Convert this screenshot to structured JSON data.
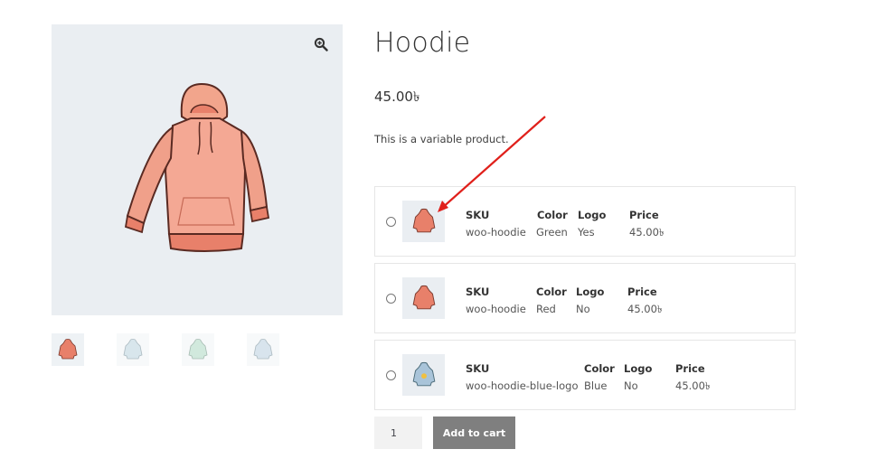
{
  "product": {
    "title": "Hoodie",
    "price": "45.00৳",
    "description": "This is a variable product."
  },
  "gallery": {
    "zoom_icon": "zoom-in-icon",
    "main_image": "pink-hoodie-image",
    "thumbnails": [
      {
        "name": "pink-hoodie",
        "color": "#e8806a"
      },
      {
        "name": "blue-hoodie",
        "color": "#a9c9d6"
      },
      {
        "name": "green-hoodie",
        "color": "#9bd0b6"
      },
      {
        "name": "blue-hoodie-logo",
        "color": "#a9c4d9"
      }
    ]
  },
  "variations": [
    {
      "headers": {
        "sku": "SKU",
        "color": "Color",
        "logo": "Logo",
        "price": "Price"
      },
      "values": {
        "sku": "woo-hoodie",
        "color": "Green",
        "logo": "Yes",
        "price": "45.00৳"
      },
      "image_color": "#e8806a"
    },
    {
      "headers": {
        "sku": "SKU",
        "color": "Color",
        "logo": "Logo",
        "price": "Price"
      },
      "values": {
        "sku": "woo-hoodie",
        "color": "Red",
        "logo": "No",
        "price": "45.00৳"
      },
      "image_color": "#e8806a"
    },
    {
      "headers": {
        "sku": "SKU",
        "color": "Color",
        "logo": "Logo",
        "price": "Price"
      },
      "values": {
        "sku": "woo-hoodie-blue-logo",
        "color": "Blue",
        "logo": "No",
        "price": "45.00৳"
      },
      "image_color": "#a9c4d9"
    }
  ],
  "cart": {
    "quantity": "1",
    "add_label": "Add to cart"
  },
  "colors": {
    "accent_arrow": "#e0201b",
    "button_bg": "#7f7f7f"
  }
}
